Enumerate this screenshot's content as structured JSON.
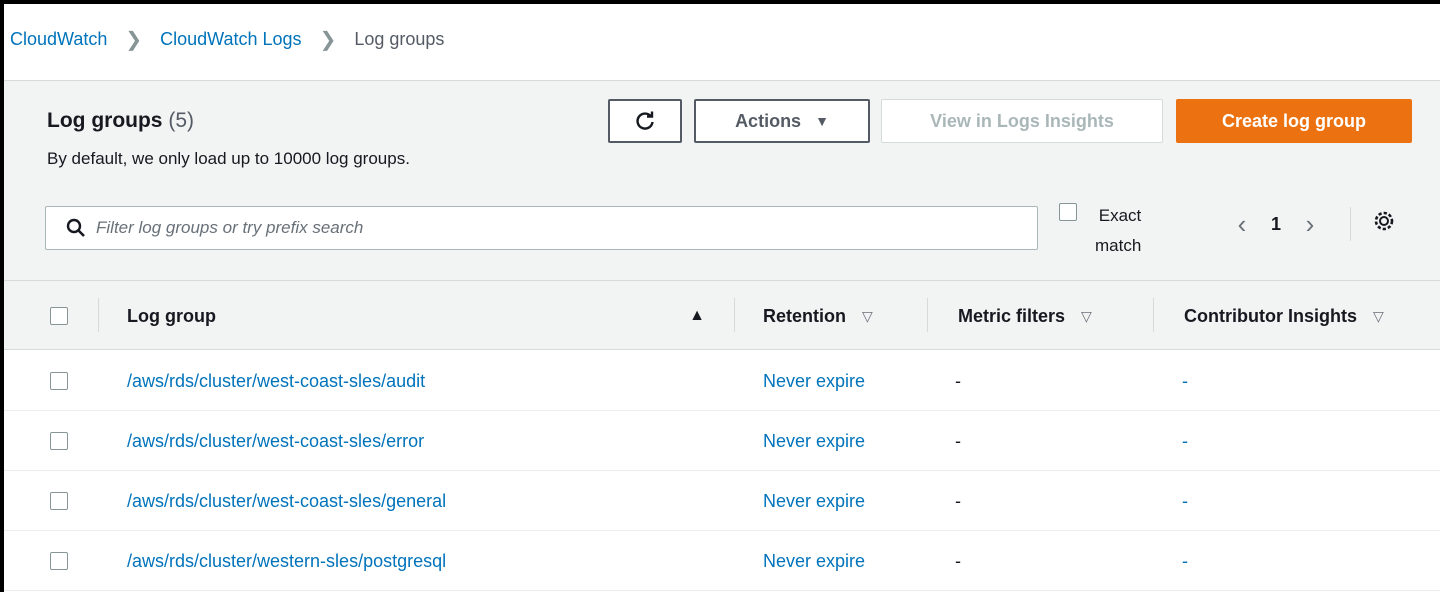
{
  "breadcrumb": {
    "items": [
      "CloudWatch",
      "CloudWatch Logs"
    ],
    "current": "Log groups"
  },
  "header": {
    "title": "Log groups",
    "count": "(5)",
    "subtitle": "By default, we only load up to 10000 log groups."
  },
  "toolbar": {
    "actions_label": "Actions",
    "view_insights_label": "View in Logs Insights",
    "create_label": "Create log group"
  },
  "search": {
    "placeholder": "Filter log groups or try prefix search"
  },
  "exact_match": {
    "label_line1": "Exact",
    "label_line2": "match",
    "checked": false
  },
  "pagination": {
    "current_page": "1"
  },
  "table": {
    "columns": [
      "Log group",
      "Retention",
      "Metric filters",
      "Contributor Insights"
    ],
    "rows": [
      {
        "log_group": "/aws/rds/cluster/west-coast-sles/audit",
        "retention": "Never expire",
        "metric_filters": "-",
        "contributor_insights": "-"
      },
      {
        "log_group": "/aws/rds/cluster/west-coast-sles/error",
        "retention": "Never expire",
        "metric_filters": "-",
        "contributor_insights": "-"
      },
      {
        "log_group": "/aws/rds/cluster/west-coast-sles/general",
        "retention": "Never expire",
        "metric_filters": "-",
        "contributor_insights": "-"
      },
      {
        "log_group": "/aws/rds/cluster/western-sles/postgresql",
        "retention": "Never expire",
        "metric_filters": "-",
        "contributor_insights": "-"
      }
    ]
  },
  "colors": {
    "link": "#0073bb",
    "primary_button": "#ec7211",
    "header_bg": "#f2f3f3"
  }
}
